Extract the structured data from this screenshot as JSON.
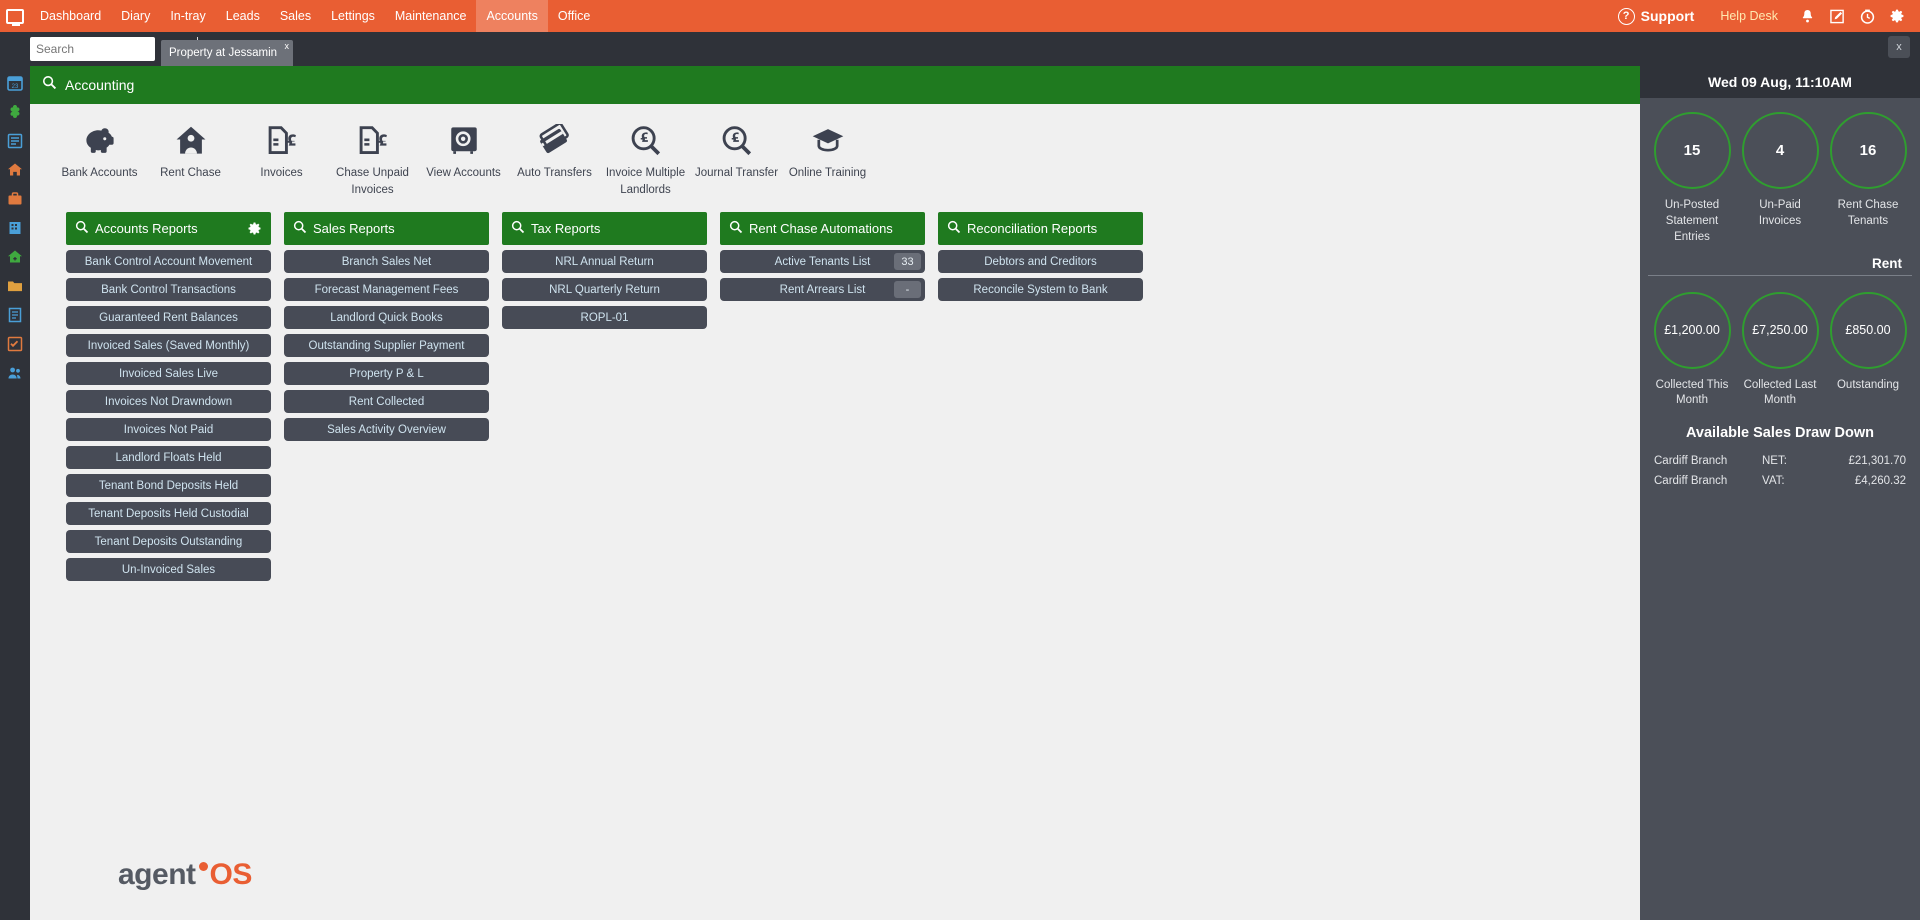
{
  "topbar": {
    "logo_icon": "dashboard-monitor-icon",
    "nav": [
      {
        "label": "Dashboard",
        "active": false
      },
      {
        "label": "Diary",
        "active": false
      },
      {
        "label": "In-tray",
        "active": false
      },
      {
        "label": "Leads",
        "active": false
      },
      {
        "label": "Sales",
        "active": false
      },
      {
        "label": "Lettings",
        "active": false
      },
      {
        "label": "Maintenance",
        "active": false
      },
      {
        "label": "Accounts",
        "active": true
      },
      {
        "label": "Office",
        "active": false
      }
    ],
    "support_label": "Support",
    "helpdesk_label": "Help Desk",
    "icons": [
      "alert-icon",
      "edit-icon",
      "clock-icon",
      "gear-icon"
    ],
    "accent_color": "#e95e33"
  },
  "searchbar": {
    "search_value": "",
    "search_placeholder": "Search",
    "open_tab": "Property at Jessamin",
    "tab_close_label": "x",
    "window_close_label": "x"
  },
  "main": {
    "header_title": "Accounting",
    "header_icon": "report-search-icon",
    "header_color": "#1f7a1f",
    "toolbar": [
      {
        "label": "Bank Accounts",
        "icon": "piggy-bank-icon"
      },
      {
        "label": "Rent Chase",
        "icon": "house-person-icon"
      },
      {
        "label": "Invoices",
        "icon": "invoice-pound-icon"
      },
      {
        "label": "Chase Unpaid Invoices",
        "icon": "invoice-pound-icon"
      },
      {
        "label": "View Accounts",
        "icon": "safe-icon"
      },
      {
        "label": "Auto Transfers",
        "icon": "cards-icon"
      },
      {
        "label": "Invoice Multiple Landlords",
        "icon": "pound-search-icon"
      },
      {
        "label": "Journal Transfer",
        "icon": "pound-search-icon"
      },
      {
        "label": "Online Training",
        "icon": "graduation-cap-icon"
      }
    ],
    "columns": [
      {
        "title": "Accounts Reports",
        "has_gear": true,
        "items": [
          {
            "label": "Bank Control Account Movement"
          },
          {
            "label": "Bank Control Transactions"
          },
          {
            "label": "Guaranteed Rent Balances"
          },
          {
            "label": "Invoiced Sales (Saved Monthly)"
          },
          {
            "label": "Invoiced Sales Live"
          },
          {
            "label": "Invoices Not Drawndown"
          },
          {
            "label": "Invoices Not Paid"
          },
          {
            "label": "Landlord Floats Held"
          },
          {
            "label": "Tenant Bond Deposits Held"
          },
          {
            "label": "Tenant Deposits Held Custodial"
          },
          {
            "label": "Tenant Deposits Outstanding"
          },
          {
            "label": "Un-Invoiced Sales"
          }
        ]
      },
      {
        "title": "Sales Reports",
        "has_gear": false,
        "items": [
          {
            "label": "Branch Sales Net"
          },
          {
            "label": "Forecast Management Fees"
          },
          {
            "label": "Landlord Quick Books"
          },
          {
            "label": "Outstanding Supplier Payment"
          },
          {
            "label": "Property P & L"
          },
          {
            "label": "Rent Collected"
          },
          {
            "label": "Sales Activity Overview"
          }
        ]
      },
      {
        "title": "Tax Reports",
        "has_gear": false,
        "items": [
          {
            "label": "NRL Annual Return"
          },
          {
            "label": "NRL Quarterly Return"
          },
          {
            "label": "ROPL-01"
          }
        ]
      },
      {
        "title": "Rent Chase Automations",
        "has_gear": false,
        "items": [
          {
            "label": "Active Tenants List",
            "badge": "33"
          },
          {
            "label": "Rent Arrears List",
            "badge": "-"
          }
        ]
      },
      {
        "title": "Reconciliation Reports",
        "has_gear": false,
        "items": [
          {
            "label": "Debtors and Creditors"
          },
          {
            "label": "Reconcile System to Bank"
          }
        ]
      }
    ],
    "brand_primary": "agent",
    "brand_secondary": "OS"
  },
  "rightpanel": {
    "datetime": "Wed 09 Aug, 11:10AM",
    "top_stats": [
      {
        "value": "15",
        "caption": "Un-Posted Statement Entries"
      },
      {
        "value": "4",
        "caption": "Un-Paid Invoices"
      },
      {
        "value": "16",
        "caption": "Rent Chase Tenants"
      }
    ],
    "rent_title": "Rent",
    "rent_stats": [
      {
        "value": "£1,200.00",
        "caption": "Collected This Month"
      },
      {
        "value": "£7,250.00",
        "caption": "Collected Last Month"
      },
      {
        "value": "£850.00",
        "caption": "Outstanding"
      }
    ],
    "drawdown_title": "Available Sales Draw Down",
    "drawdown_rows": [
      {
        "branch": "Cardiff Branch",
        "label": "NET:",
        "value": "£21,301.70"
      },
      {
        "branch": "Cardiff Branch",
        "label": "VAT:",
        "value": "£4,260.32"
      }
    ],
    "ring_color": "#2f9e2f"
  },
  "rail": {
    "items": [
      "calendar-icon",
      "clover-icon",
      "list-icon",
      "home-icon",
      "briefcase-icon",
      "building-icon",
      "house-plus-icon",
      "folder-icon",
      "doc-icon",
      "checklist-icon",
      "people-icon"
    ]
  }
}
